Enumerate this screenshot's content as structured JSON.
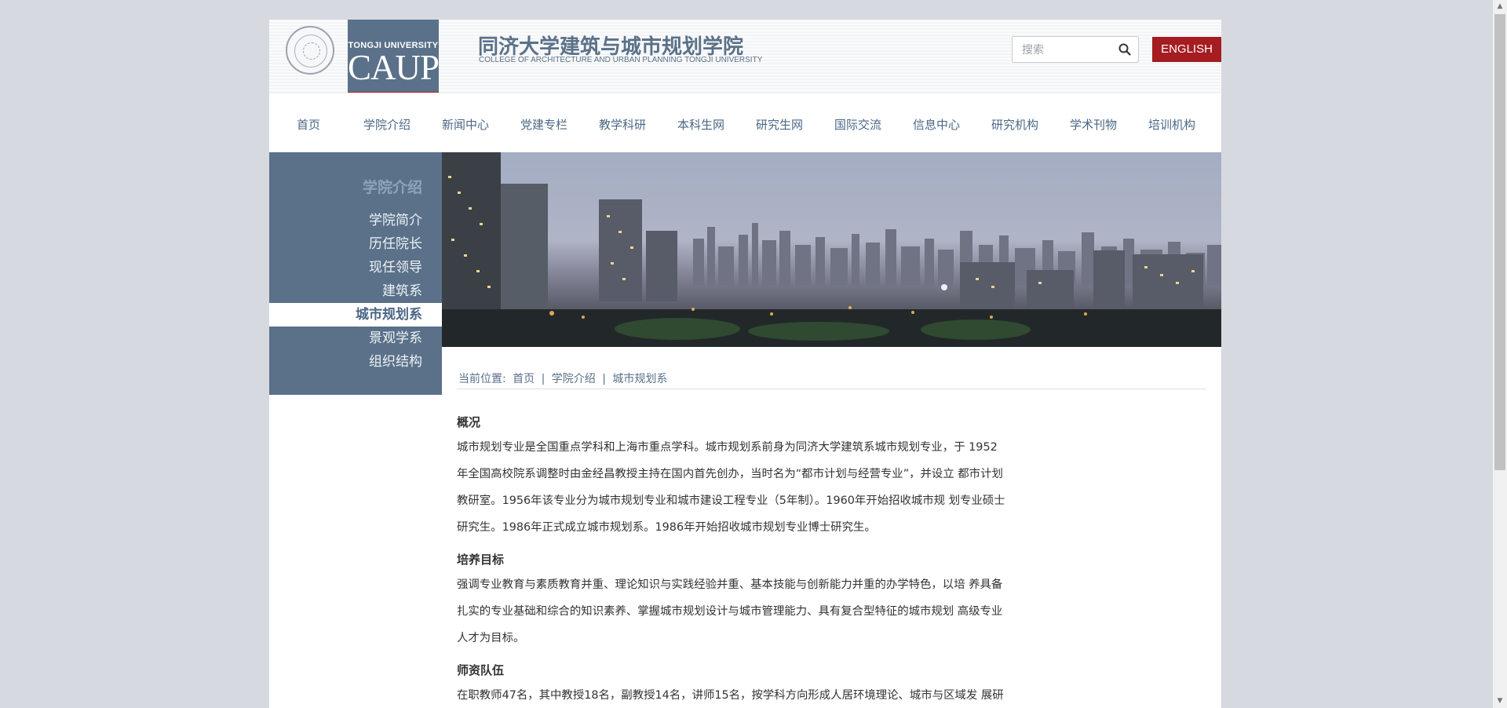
{
  "header": {
    "logo_university": "TONGJI UNIVERSITY",
    "logo_caup": "CAUP",
    "college_name_cn": "同济大学建筑与城市规划学院",
    "college_name_en": "COLLEGE OF ARCHITECTURE AND URBAN PLANNING TONGJI UNIVERSITY",
    "search_placeholder": "搜索",
    "english_label": "ENGLISH",
    "colors": {
      "brand": "#5a7189",
      "accent": "#a51c21"
    }
  },
  "nav": {
    "items": [
      "首页",
      "学院介绍",
      "新闻中心",
      "党建专栏",
      "教学科研",
      "本科生网",
      "研究生网",
      "国际交流",
      "信息中心",
      "研究机构",
      "学术刊物",
      "培训机构"
    ]
  },
  "sidebar": {
    "title": "学院介绍",
    "items": [
      "学院简介",
      "历任院长",
      "现任领导",
      "建筑系",
      "城市规划系",
      "景观学系",
      "组织结构"
    ],
    "active": "城市规划系"
  },
  "breadcrumb": {
    "prefix": "当前位置:",
    "items": [
      "首页",
      "学院介绍",
      "城市规划系"
    ],
    "separator": "|"
  },
  "content": {
    "sections": [
      {
        "title": "概况",
        "lines": [
          "城市规划专业是全国重点学科和上海市重点学科。城市规划系前身为同济大学建筑系城市规划专业，于 1952",
          "年全国高校院系调整时由金经昌教授主持在国内首先创办，当时名为“都市计划与经营专业”，并设立 都市计划",
          "教研室。1956年该专业分为城市规划专业和城市建设工程专业（5年制）。1960年开始招收城市规 划专业硕士",
          "研究生。1986年正式成立城市规划系。1986年开始招收城市规划专业博士研究生。"
        ]
      },
      {
        "title": "培养目标",
        "lines": [
          "强调专业教育与素质教育并重、理论知识与实践经验并重、基本技能与创新能力并重的办学特色，以培 养具备",
          "扎实的专业基础和综合的知识素养、掌握城市规划设计与城市管理能力、具有复合型特征的城市规划 高级专业",
          "人才为目标。"
        ]
      },
      {
        "title": "师资队伍",
        "lines": [
          "在职教师47名，其中教授18名，副教授14名，讲师15名，按学科方向形成人居环境理论、城市与区域发 展研"
        ]
      }
    ]
  }
}
